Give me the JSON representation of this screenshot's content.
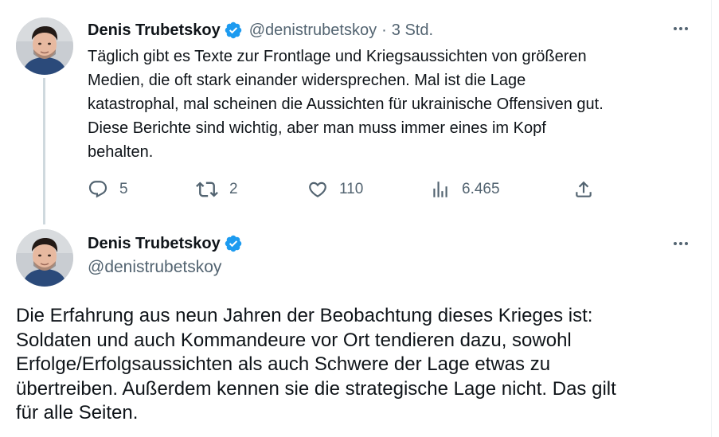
{
  "tweets": [
    {
      "author": {
        "display_name": "Denis Trubetskoy",
        "handle": "@denistrubetskoy",
        "verified_icon": "verified-badge-icon",
        "avatar": "profile-photo"
      },
      "separator": "·",
      "timestamp": "3 Std.",
      "more_icon": "more-options-icon",
      "text_lines": [
        "Täglich gibt es Texte zur Frontlage und Kriegsaussichten von größeren",
        "Medien, die oft stark einander widersprechen. Mal ist die Lage",
        "katastrophal, mal scheinen die Aussichten für ukrainische Offensiven gut.",
        "Diese Berichte sind wichtig, aber man muss immer eines im Kopf",
        "behalten."
      ],
      "actions": {
        "replies": "5",
        "retweets": "2",
        "likes": "110",
        "views": "6.465"
      }
    },
    {
      "author": {
        "display_name": "Denis Trubetskoy",
        "handle": "@denistrubetskoy",
        "verified_icon": "verified-badge-icon",
        "avatar": "profile-photo"
      },
      "more_icon": "more-options-icon",
      "text_lines": [
        "Die Erfahrung aus neun Jahren der Beobachtung dieses Krieges ist:",
        "Soldaten und auch Kommandeure vor Ort tendieren dazu, sowohl",
        "Erfolge/Erfolgsaussichten als auch Schwere der Lage etwas zu",
        "übertreiben. Außerdem kennen sie die strategische Lage nicht. Das gilt",
        "für alle Seiten."
      ]
    }
  ],
  "colors": {
    "text_primary": "#0f1419",
    "text_secondary": "#536471",
    "verified_blue": "#1d9bf0",
    "thread_line": "#cfd9de"
  }
}
